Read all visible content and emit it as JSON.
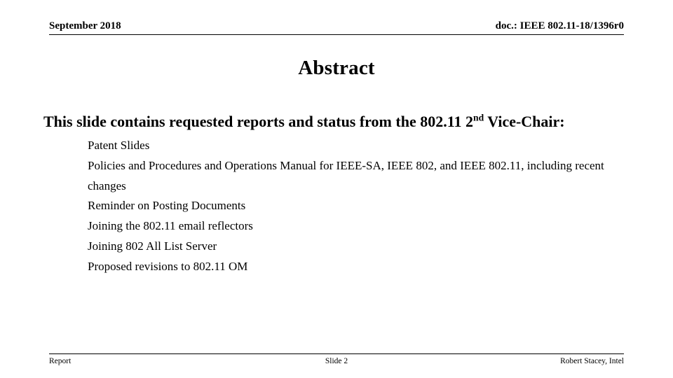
{
  "header": {
    "date": "September 2018",
    "doc_reference": "doc.: IEEE 802.11-18/1396r0"
  },
  "title": "Abstract",
  "body": {
    "lead": {
      "before_sup": "This slide contains requested reports and status from the 802.11 2",
      "sup": "nd",
      "after_sup": " Vice-Chair:"
    },
    "items": [
      "Patent Slides",
      "Policies and Procedures and Operations Manual for IEEE-SA, IEEE 802, and IEEE 802.11, including recent changes",
      "Reminder on Posting Documents",
      "Joining the 802.11 email reflectors",
      "Joining 802 All List Server",
      "Proposed revisions to 802.11 OM"
    ]
  },
  "footer": {
    "left": "Report",
    "center": "Slide 2",
    "right": "Robert Stacey, Intel"
  },
  "colors": {
    "background": "#ffffff",
    "text": "#000000",
    "rule": "#000000"
  }
}
